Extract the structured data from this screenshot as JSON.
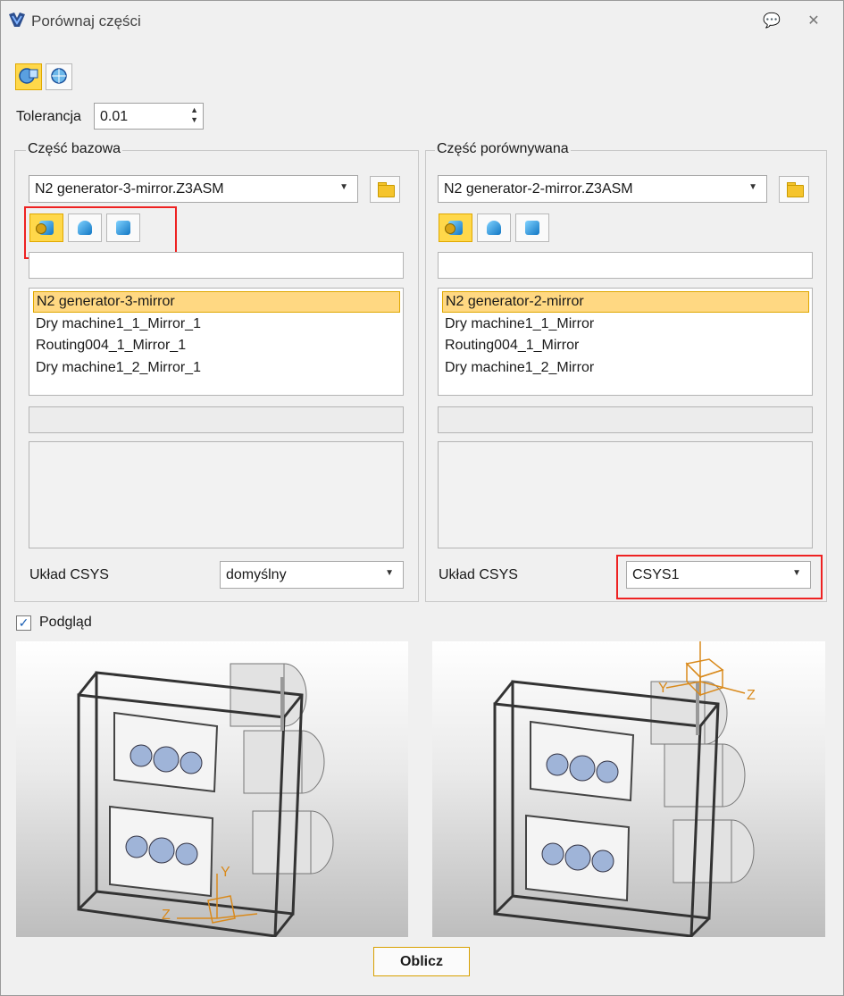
{
  "window": {
    "title": "Porównaj części",
    "help_glyph": "💬",
    "close_glyph": "✕"
  },
  "tolerance": {
    "label": "Tolerancja",
    "value": "0.01"
  },
  "base_part": {
    "group_title": "Część bazowa",
    "file": "N2 generator-3-mirror.Z3ASM",
    "filter": "",
    "items": [
      "N2 generator-3-mirror",
      "Dry machine1_1_Mirror_1",
      "Routing004_1_Mirror_1",
      "Dry machine1_2_Mirror_1"
    ],
    "selected_index": 0,
    "csys_label": "Układ CSYS",
    "csys_value": "domyślny"
  },
  "compared_part": {
    "group_title": "Część porównywana",
    "file": "N2 generator-2-mirror.Z3ASM",
    "filter": "",
    "items": [
      "N2 generator-2-mirror",
      "Dry machine1_1_Mirror",
      "Routing004_1_Mirror",
      "Dry machine1_2_Mirror"
    ],
    "selected_index": 0,
    "csys_label": "Układ CSYS",
    "csys_value": "CSYS1"
  },
  "preview": {
    "label": "Podgląd",
    "checked": true,
    "axis_labels_right": [
      "Y",
      "Z"
    ],
    "axis_labels_left": [
      "Z",
      "Y"
    ]
  },
  "compute_button": "Oblicz",
  "colors": {
    "accent_yellow": "#ffd84a",
    "highlight_red": "#e22222",
    "axis_orange": "#d98a1c"
  },
  "icons": [
    "app-logo-icon",
    "comment-icon",
    "close-icon",
    "compare-mode-icon",
    "globe-mode-icon",
    "folder-icon",
    "assembly-icon",
    "shell-icon",
    "solid-icon",
    "checkbox-checked-icon"
  ]
}
